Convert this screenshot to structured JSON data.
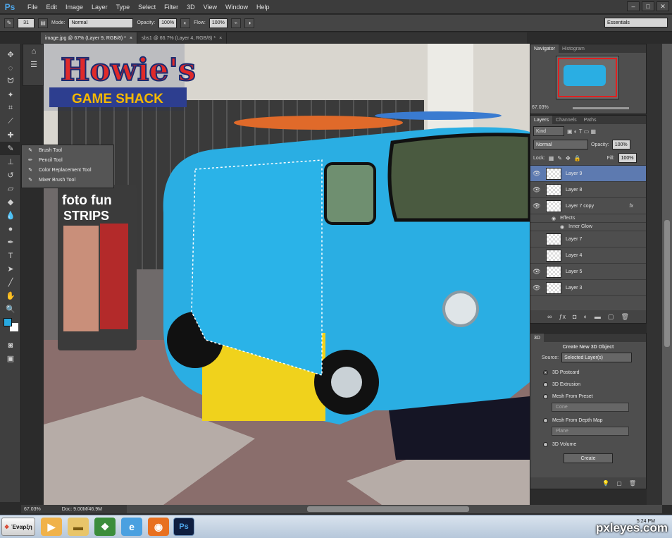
{
  "app": {
    "logo": "Ps"
  },
  "menubar": {
    "items": [
      "File",
      "Edit",
      "Image",
      "Layer",
      "Type",
      "Select",
      "Filter",
      "3D",
      "View",
      "Window",
      "Help"
    ],
    "min": "–",
    "max": "□",
    "close": "✕"
  },
  "options": {
    "size": "31",
    "mode_label": "Mode:",
    "mode_value": "Normal",
    "opacity_label": "Opacity:",
    "opacity_value": "100%",
    "flow_label": "Flow:",
    "flow_value": "100%",
    "workspace": "Essentials"
  },
  "tabs": [
    {
      "label": "image.jpg @ 67% (Layer 9, RGB/8) *"
    },
    {
      "label": "sbs1 @ 66.7% (Layer 4, RGB/8) *"
    }
  ],
  "flyout": {
    "items": [
      "Brush Tool",
      "Pencil Tool",
      "Color Replacement Tool",
      "Mixer Brush Tool"
    ],
    "shortcut": "B"
  },
  "canvas": {
    "sign_text": "Howie's",
    "sign_sub": "GAME SHACK",
    "booth_title": "foto fun",
    "booth_sub": "STRIPS"
  },
  "colors": {
    "fg": "#29a9e0",
    "bg": "#ffffff",
    "van": "#2aaee3",
    "selection_fill": "#2ab3e8",
    "layer_sel": "#5d7ab0"
  },
  "status": {
    "zoom": "67.03%",
    "doc": "Doc: 9.00M/46.9M"
  },
  "navigator": {
    "tabs": [
      "Navigator",
      "Histogram"
    ],
    "zoom": "67.03%"
  },
  "layers": {
    "tabs": [
      "Layers",
      "Channels",
      "Paths"
    ],
    "kind": "Kind",
    "blend": "Normal",
    "opacity_label": "Opacity:",
    "opacity_value": "100%",
    "lock_label": "Lock:",
    "fill_label": "Fill:",
    "fill_value": "100%",
    "list": [
      {
        "name": "Layer 9",
        "visible": "👁"
      },
      {
        "name": "Layer 8",
        "visible": "👁"
      },
      {
        "name": "Layer 7 copy",
        "visible": "👁",
        "fx": "fx"
      },
      {
        "name": "Layer 7",
        "visible": ""
      },
      {
        "name": "Layer 4",
        "visible": ""
      },
      {
        "name": "Layer 5",
        "visible": "👁"
      },
      {
        "name": "Layer 3",
        "visible": "👁"
      }
    ],
    "effects": "Effects",
    "inner_glow": "Inner Glow"
  },
  "panel3d": {
    "tab": "3D",
    "title": "Create New 3D Object",
    "source_label": "Source:",
    "source_value": "Selected Layer(s)",
    "options": [
      "3D Postcard",
      "3D Extrusion",
      "Mesh From Preset",
      "Mesh From Depth Map",
      "3D Volume"
    ],
    "preset_value": "Cone",
    "depth_value": "Plane",
    "create": "Create"
  },
  "taskbar": {
    "start": "Έναρξη",
    "time": "5:24 PM"
  },
  "watermark": "pxleyes.com"
}
